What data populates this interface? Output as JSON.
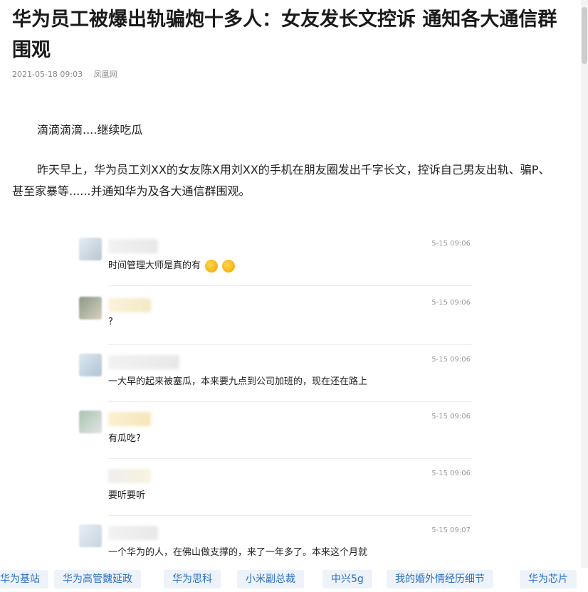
{
  "article": {
    "title": "华为员工被爆出轨骗炮十多人：女友发长文控诉 通知各大通信群围观",
    "date": "2021-05-18 09:03",
    "source": "凤凰网",
    "paragraphs": [
      "滴滴滴滴....继续吃瓜",
      "昨天早上，华为员工刘XX的女友陈X用刘XX的手机在朋友圈发出千字长文，控诉自己男友出轨、骗P、甚至家暴等......并通知华为及各大通信群围观。"
    ]
  },
  "chat": {
    "messages": [
      {
        "time": "5-15 09:06",
        "text": "时间管理大师是真的有"
      },
      {
        "time": "5-15 09:06",
        "text": "?"
      },
      {
        "time": "5-15 09:06",
        "text": "一大早的起来被塞瓜，本来要九点到公司加班的，现在还在路上"
      },
      {
        "time": "5-15 09:06",
        "text": "有瓜吃?"
      },
      {
        "time": "5-15 09:06",
        "text": "要听要听"
      },
      {
        "time": "5-15 09:07",
        "text": "一个华为的人，在佛山做支撑的，来了一年多了。本来这个月就"
      }
    ]
  },
  "tags": [
    "华为基站",
    "华为高管魏延政",
    "华为思科",
    "小米副总裁",
    "中兴5g",
    "我的婚外情经历细节",
    "华为芯片"
  ],
  "colors": {
    "tag_text": "#2a6fc4",
    "tag_bg": "#eef3fa"
  }
}
